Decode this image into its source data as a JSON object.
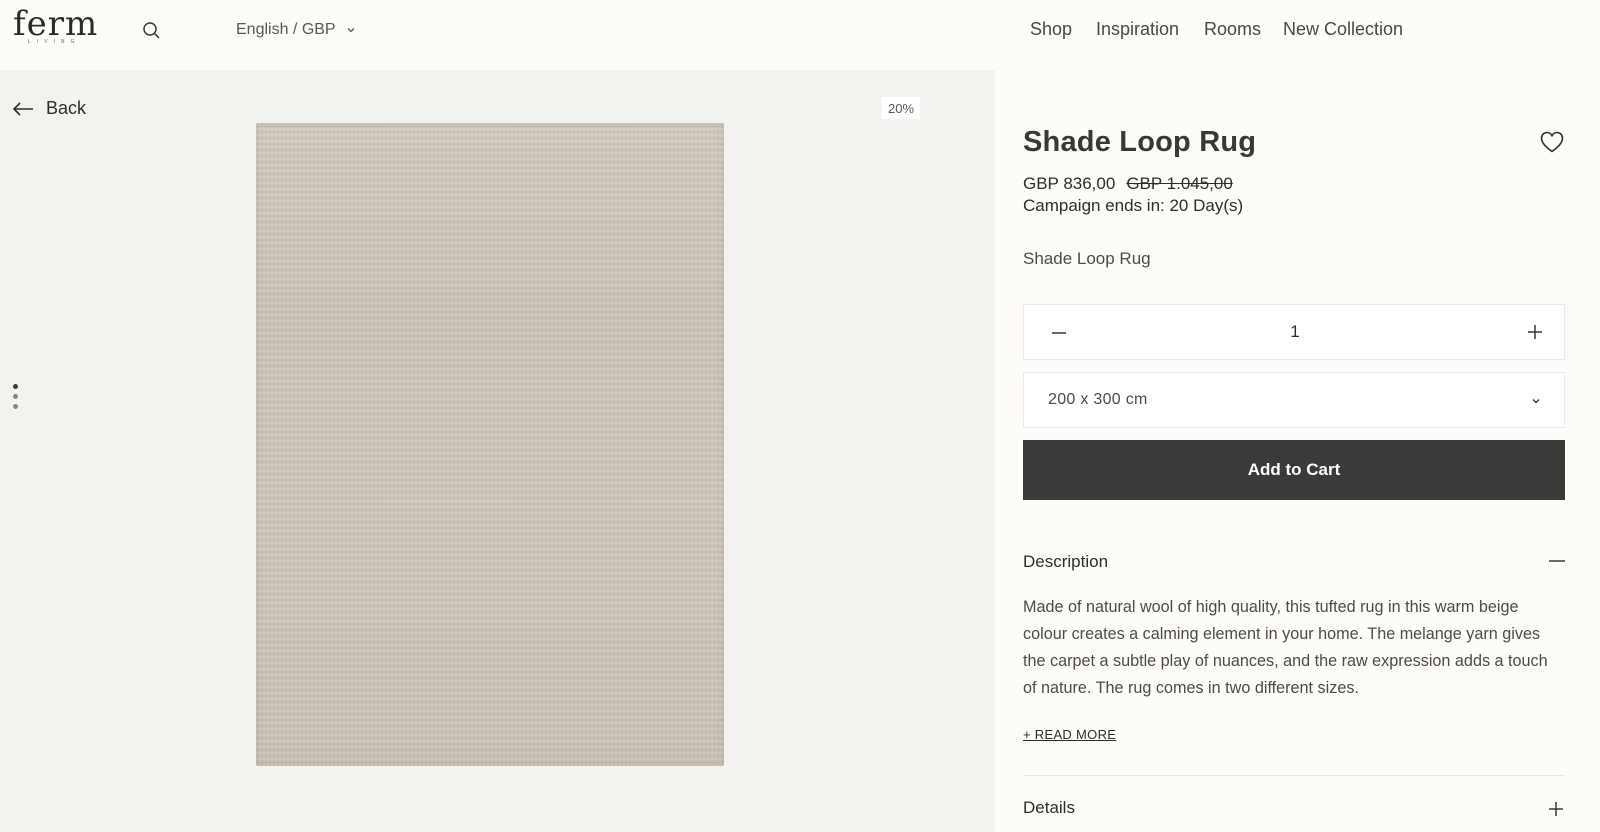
{
  "header": {
    "logo": "ferm",
    "logo_sub": "LIVING",
    "locale": "English / GBP",
    "nav": [
      "Shop",
      "Inspiration",
      "Rooms",
      "New Collection"
    ]
  },
  "gallery": {
    "back_label": "Back",
    "discount_badge": "20%",
    "image_alt": "Shade Loop Rug"
  },
  "product": {
    "title": "Shade Loop Rug",
    "price": "GBP 836,00",
    "price_old": "GBP 1.045,00",
    "campaign": "Campaign ends in: 20 Day(s)",
    "variant_name": "Shade Loop Rug",
    "quantity": "1",
    "size": "200 x 300 cm",
    "add_to_cart": "Add to Cart",
    "description_heading": "Description",
    "description_text": "Made of natural wool of high quality, this tufted rug in this warm beige colour creates a calming element in your home. The melange yarn gives the carpet a subtle play of nuances, and the raw expression adds a touch of nature. The rug comes in two different sizes.",
    "read_more": "+ READ MORE",
    "details_heading": "Details"
  },
  "colors": {
    "accent_button": "#3b3a38",
    "background": "#fdfcf9",
    "gallery_background": "#f4f2ee"
  }
}
